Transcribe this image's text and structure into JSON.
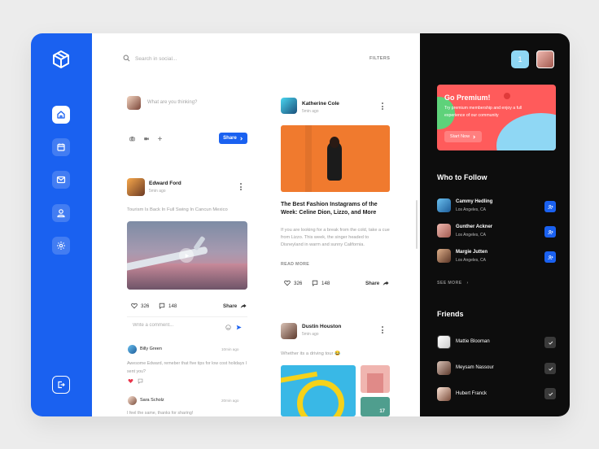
{
  "colors": {
    "accent": "#1a61f0",
    "sidebar": "#1a61f0",
    "dark_panel": "#0d0d0d",
    "promo": "#ff5b5b",
    "like": "#e8344a"
  },
  "sidebar": {
    "items": [
      {
        "icon": "home-icon",
        "active": true
      },
      {
        "icon": "calendar-icon",
        "active": false
      },
      {
        "icon": "mail-icon",
        "active": false
      },
      {
        "icon": "user-icon",
        "active": false
      },
      {
        "icon": "settings-icon",
        "active": false
      }
    ],
    "logout_icon": "logout-icon"
  },
  "search": {
    "placeholder": "Search in social...",
    "filters_label": "FILTERS"
  },
  "composer": {
    "placeholder": "What are you thinking?",
    "share_label": "Share"
  },
  "post1": {
    "author": "Edward Ford",
    "time": "5min ago",
    "text": "Tourism Is Back In Full Swing In Cancun Mexico",
    "likes": "326",
    "comments": "148",
    "share_label": "Share",
    "comment_placeholder": "Write a comment...",
    "comments_list": [
      {
        "author": "Billy Green",
        "time": "10min ago",
        "text": "Awesome Edward, remeber that five tips for low cost holidays I sent you?"
      },
      {
        "author": "Sara Scholz",
        "time": "20min ago",
        "text": "I feel the same, thanks for sharing!"
      }
    ]
  },
  "post2": {
    "author": "Katherine Cole",
    "time": "5min ago",
    "title": "The Best Fashion Instagrams of the Week: Celine Dion, Lizzo, and More",
    "text": "If you are looking for a break from the cold, take a cue from Lizzo. This week, the singer headed to Disneyland in warm and sunny California.",
    "read_more": "READ MORE",
    "likes": "326",
    "comments": "148",
    "share_label": "Share"
  },
  "post3": {
    "author": "Dustin Houston",
    "time": "5min ago",
    "text": "Whether its a driving tour 😂",
    "extra_count": "17"
  },
  "right": {
    "notification_count": "1",
    "promo": {
      "title": "Go Premium!",
      "text": "Try premium membership and enjoy a full experience of our community",
      "button": "Start Now"
    },
    "follow_title": "Who to Follow",
    "follow": [
      {
        "name": "Cammy Hedling",
        "location": "Los Angeles, CA"
      },
      {
        "name": "Gunther Ackner",
        "location": "Los Angeles, CA"
      },
      {
        "name": "Margie Jutten",
        "location": "Los Angeles, CA"
      }
    ],
    "see_more": "SEE MORE",
    "friends_title": "Friends",
    "friends": [
      {
        "name": "Mattie Blooman"
      },
      {
        "name": "Meysam Nassour"
      },
      {
        "name": "Hubert Franck"
      }
    ]
  }
}
